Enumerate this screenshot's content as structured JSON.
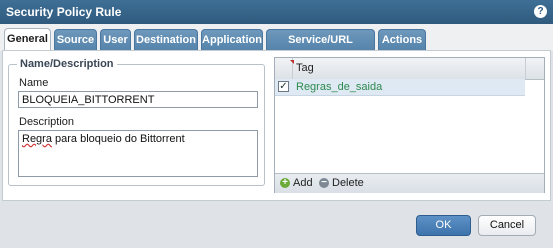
{
  "window": {
    "title": "Security Policy Rule",
    "help_icon": "?"
  },
  "tabs": [
    {
      "label": "General",
      "active": true
    },
    {
      "label": "Source"
    },
    {
      "label": "User"
    },
    {
      "label": "Destination"
    },
    {
      "label": "Application"
    },
    {
      "label": "Service/URL Category"
    },
    {
      "label": "Actions"
    }
  ],
  "name_description": {
    "legend": "Name/Description",
    "name_label": "Name",
    "name_value": "BLOQUEIA_BITTORRENT",
    "description_label": "Description",
    "description_value_part1": "Regra",
    "description_value_part2": " para bloqueio do Bittorrent"
  },
  "tags": {
    "column_header": "Tag",
    "rows": [
      {
        "value": "Regras_de_saida",
        "checked": true
      }
    ],
    "add_label": "Add",
    "delete_label": "Delete"
  },
  "footer": {
    "ok_label": "OK",
    "cancel_label": "Cancel"
  },
  "colors": {
    "title_bar": "#2f5a7e",
    "tab_inactive": "#5e8db4",
    "tag_value": "#2d8a4e",
    "ok_button": "#4a80b8"
  }
}
